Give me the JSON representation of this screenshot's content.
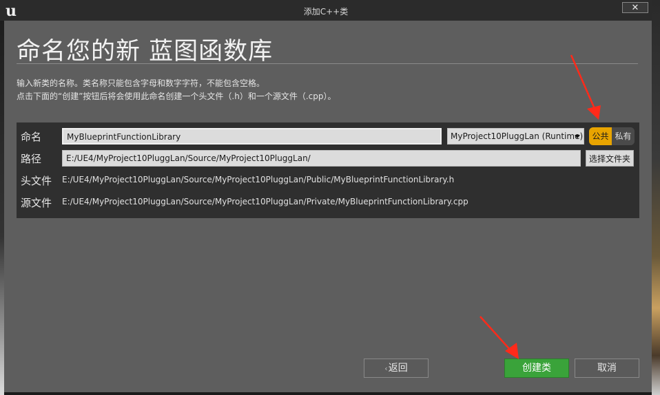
{
  "window": {
    "title": "添加C++类",
    "close_symbol": "✕"
  },
  "dialog": {
    "heading": "命名您的新 蓝图函数库",
    "description_line1": "输入新类的名称。类名称只能包含字母和数字字符，不能包含空格。",
    "description_line2": "点击下面的“创建”按钮后将会使用此命名创建一个头文件（.h）和一个源文件（.cpp）。"
  },
  "form": {
    "name_label": "命名",
    "name_value": "MyBlueprintFunctionLibrary",
    "module_value": "MyProject10PluggLan (Runtime)",
    "visibility": {
      "public_label": "公共",
      "private_label": "私有",
      "selected": "public"
    },
    "path_label": "路径",
    "path_value": "E:/UE4/MyProject10PluggLan/Source/MyProject10PluggLan/",
    "choose_folder_label": "选择文件夹",
    "header_label": "头文件",
    "header_path": "E:/UE4/MyProject10PluggLan/Source/MyProject10PluggLan/Public/MyBlueprintFunctionLibrary.h",
    "source_label": "源文件",
    "source_path": "E:/UE4/MyProject10PluggLan/Source/MyProject10PluggLan/Private/MyBlueprintFunctionLibrary.cpp"
  },
  "buttons": {
    "back": "返回",
    "create": "创建类",
    "cancel": "取消"
  },
  "colors": {
    "accent_public": "#e8a400",
    "create_green": "#3aa33a",
    "annotation_red": "#ff2a1a"
  },
  "icons": [
    "unreal-logo-icon",
    "close-icon",
    "chevron-left-icon",
    "dropdown-arrow-icon"
  ]
}
